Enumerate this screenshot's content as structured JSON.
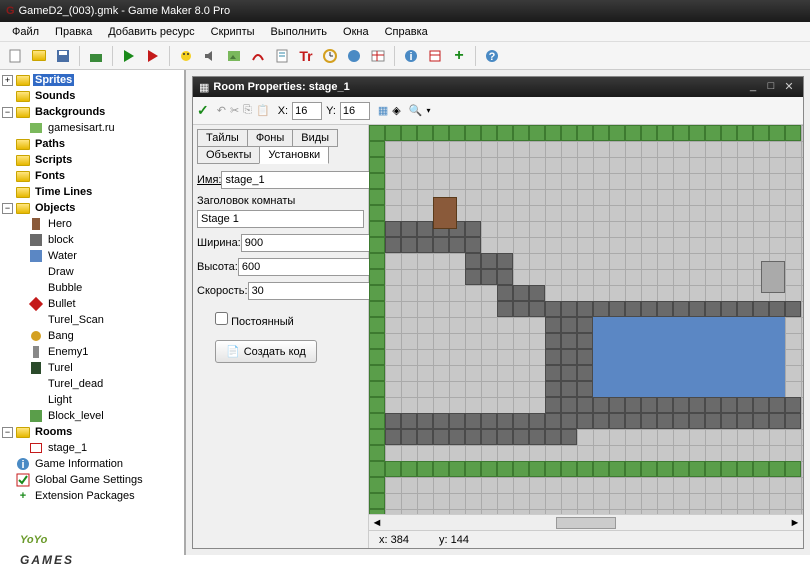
{
  "title": "GameD2_(003).gmk - Game Maker 8.0 Pro",
  "menu": [
    "Файл",
    "Правка",
    "Добавить ресурс",
    "Скрипты",
    "Выполнить",
    "Окна",
    "Справка"
  ],
  "tree": {
    "sprites": "Sprites",
    "sounds": "Sounds",
    "backgrounds": "Backgrounds",
    "bg_item": "gamesisart.ru",
    "paths": "Paths",
    "scripts": "Scripts",
    "fonts": "Fonts",
    "timelines": "Time Lines",
    "objects": "Objects",
    "obj": [
      "Hero",
      "block",
      "Water",
      "Draw",
      "Bubble",
      "Bullet",
      "Turel_Scan",
      "Bang",
      "Enemy1",
      "Turel",
      "Turel_dead",
      "Light",
      "Block_level"
    ],
    "rooms": "Rooms",
    "room_item": "stage_1",
    "gameinfo": "Game Information",
    "settings": "Global Game Settings",
    "ext": "Extension Packages"
  },
  "room": {
    "title": "Room Properties: stage_1",
    "xlbl": "X:",
    "x": "16",
    "ylbl": "Y:",
    "y": "16",
    "tabs": [
      "Тайлы",
      "Фоны",
      "Виды",
      "Объекты",
      "Установки"
    ],
    "name_lbl": "Имя:",
    "name": "stage_1",
    "caption_lbl": "Заголовок комнаты",
    "caption": "Stage 1",
    "width_lbl": "Ширина:",
    "width": "900",
    "height_lbl": "Высота:",
    "height": "600",
    "speed_lbl": "Скорость:",
    "speed": "30",
    "persistent": "Постоянный",
    "createcode": "Создать код",
    "status_x": "x: 384",
    "status_y": "y: 144"
  },
  "footer": {
    "p1": "YoYo",
    "p2": "GAMES"
  }
}
